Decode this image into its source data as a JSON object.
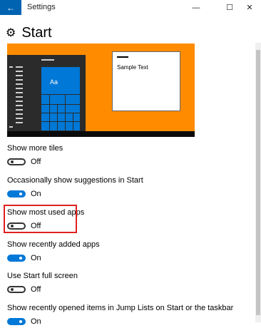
{
  "window": {
    "app_title": "Settings",
    "back_icon": "←",
    "minimize_icon": "—",
    "maximize_icon": "☐",
    "close_icon": "✕"
  },
  "page": {
    "title": "Start",
    "title_icon": "⚙"
  },
  "preview": {
    "tile_label": "Aa",
    "sample_text": "Sample Text"
  },
  "settings": [
    {
      "label": "Show more tiles",
      "state": "Off"
    },
    {
      "label": "Occasionally show suggestions in Start",
      "state": "On"
    },
    {
      "label": "Show most used apps",
      "state": "Off"
    },
    {
      "label": "Show recently added apps",
      "state": "On"
    },
    {
      "label": "Use Start full screen",
      "state": "Off"
    },
    {
      "label": "Show recently opened items in Jump Lists on Start or the taskbar",
      "state": "On"
    }
  ],
  "colors": {
    "accent": "#0078d7",
    "back_button": "#0063b1",
    "preview_background": "#ff8c00",
    "highlight": "#e02020"
  }
}
